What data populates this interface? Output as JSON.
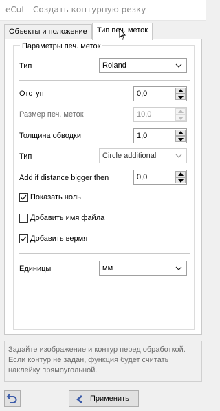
{
  "window": {
    "title": "eCut - Создать контурную резку"
  },
  "tabs": [
    {
      "label": "Объекты и положение",
      "active": false
    },
    {
      "label": "Тип печ. меток",
      "active": true
    }
  ],
  "group": {
    "title": "Параметры печ. меток"
  },
  "fields": {
    "type": {
      "label": "Тип",
      "value": "Roland"
    },
    "offset": {
      "label": "Отступ",
      "value": "0,0"
    },
    "mark_size": {
      "label": "Размер печ. меток",
      "value": "10,0",
      "disabled": true
    },
    "stroke_width": {
      "label": "Толщина обводки",
      "value": "1,0"
    },
    "mark_type": {
      "label": "Тип",
      "value": "Circle additional",
      "disabled": true
    },
    "add_distance": {
      "label": "Add if distance bigger then",
      "value": "0,0"
    },
    "units": {
      "label": "Единицы",
      "value": "мм"
    }
  },
  "checkboxes": {
    "show_zero": {
      "label": "Показать ноль",
      "checked": true
    },
    "add_filename": {
      "label": "Добавить имя файла",
      "checked": false
    },
    "add_time": {
      "label": "Добавить вермя",
      "checked": true
    }
  },
  "info": {
    "line1": "Задайте изображение и контур перед обработкой.",
    "line2": "Если контур не задан, функция будет считать",
    "line3": "наклейку прямоугольной."
  },
  "buttons": {
    "undo": {
      "icon": "undo-icon"
    },
    "apply": {
      "label": "Применить",
      "icon": "chevron-left-icon"
    }
  },
  "colors": {
    "accent_blue": "#3b5ba9",
    "check": "#1a1a1a"
  }
}
